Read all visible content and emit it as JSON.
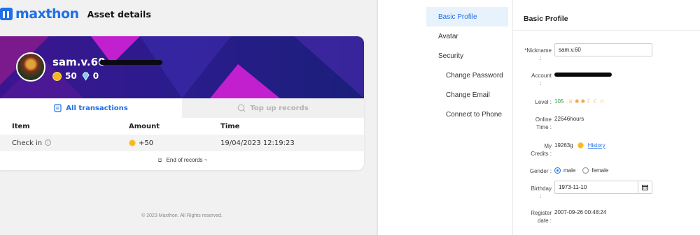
{
  "left": {
    "brand": {
      "name": "maxthon",
      "page_title": "Asset details"
    },
    "profile": {
      "username": "sam.v.60",
      "coins": "50",
      "diamonds": "0"
    },
    "tabs": [
      {
        "label": "All transactions",
        "icon": "receipt-icon",
        "active": true
      },
      {
        "label": "Top up records",
        "icon": "coin-search-icon",
        "active": false
      }
    ],
    "table": {
      "headers": [
        "Item",
        "Amount",
        "Time"
      ],
      "rows": [
        {
          "item": "Check in",
          "amount": "+50",
          "time": "19/04/2023 12:19:23"
        }
      ],
      "end_text": "End of records ~"
    },
    "footer": "© 2023 Maxthon. All Rights reserved."
  },
  "right": {
    "sidebar": [
      {
        "label": "Basic Profile",
        "active": true
      },
      {
        "label": "Avatar"
      },
      {
        "label": "Security"
      },
      {
        "label": "Change Password",
        "sub": true
      },
      {
        "label": "Change Email",
        "sub": true
      },
      {
        "label": "Connect to Phone",
        "sub": true
      }
    ],
    "section_title": "Basic Profile",
    "fields": {
      "nickname_label": "*Nickname",
      "nickname_colon": ":",
      "nickname_value": "sam.v.60",
      "account_label": "Account",
      "account_colon": ":",
      "level_label": "Level :",
      "level_value": "105",
      "online_label": "Online",
      "online_label2": "Time :",
      "online_value": "22646hours",
      "credits_label": "My",
      "credits_label2": "Credits :",
      "credits_value": "19263g",
      "history_link": "History",
      "gender_label": "Gender :",
      "gender_male": "male",
      "gender_female": "female",
      "birthday_label": "Birthday",
      "birthday_colon": ":",
      "birthday_value": "1973-11-10",
      "register_label": "Register",
      "register_label2": "date :",
      "register_value": "2007-09-26 00:48:24"
    }
  },
  "colors": {
    "accent": "#1f6fe8",
    "coin": "#f5b81f",
    "banner_purple": "#3a1a8a",
    "banner_magenta": "#c21fcf"
  }
}
